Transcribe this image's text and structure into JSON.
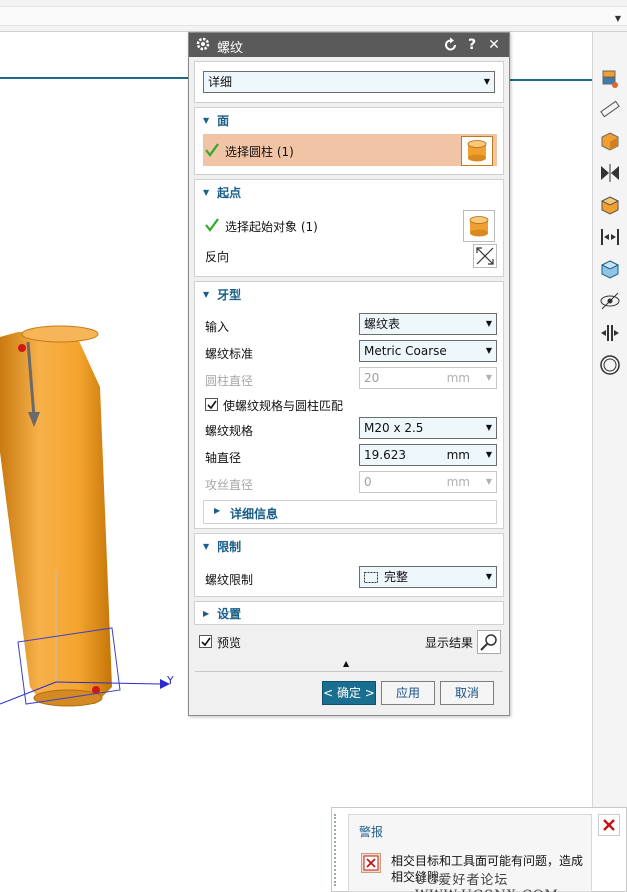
{
  "dialog": {
    "title": "螺纹",
    "reset_icon": "reset-icon",
    "help_label": "?",
    "close_label": "✕",
    "mode_select": "详细",
    "face_section": {
      "title": "面",
      "select_label": "选择圆柱 (1)"
    },
    "start_section": {
      "title": "起点",
      "select_label": "选择起始对象 (1)",
      "reverse_label": "反向"
    },
    "profile_section": {
      "title": "牙型",
      "input_label": "输入",
      "input_value": "螺纹表",
      "standard_label": "螺纹标准",
      "standard_value": "Metric Coarse",
      "cyl_dia_label": "圆柱直径",
      "cyl_dia_value": "20",
      "cyl_dia_unit": "mm",
      "match_label": "使螺纹规格与圆柱匹配",
      "spec_label": "螺纹规格",
      "spec_value": "M20 x 2.5",
      "shaft_dia_label": "轴直径",
      "shaft_dia_value": "19.623",
      "shaft_dia_unit": "mm",
      "tap_dia_label": "攻丝直径",
      "tap_dia_value": "0",
      "tap_dia_unit": "mm",
      "details_label": "详细信息"
    },
    "limit_section": {
      "title": "限制",
      "limit_label": "螺纹限制",
      "limit_value": "完整"
    },
    "settings_section": {
      "title": "设置"
    },
    "preview_label": "预览",
    "show_result_label": "显示结果",
    "ok_label": "< 确定 >",
    "apply_label": "应用",
    "cancel_label": "取消"
  },
  "alert": {
    "title": "警报",
    "message": "相交目标和工具面可能有问题，造成相交缝隙。"
  },
  "viewport": {
    "axis_y_label": "Y"
  },
  "watermark": "UG爱好者论坛 WWW.UGSNX.COM",
  "colors": {
    "accent": "#1a5f8a",
    "selection_row": "#f2c4a6",
    "cylinder": "#f0a030",
    "primary_button": "#1a6e90"
  }
}
